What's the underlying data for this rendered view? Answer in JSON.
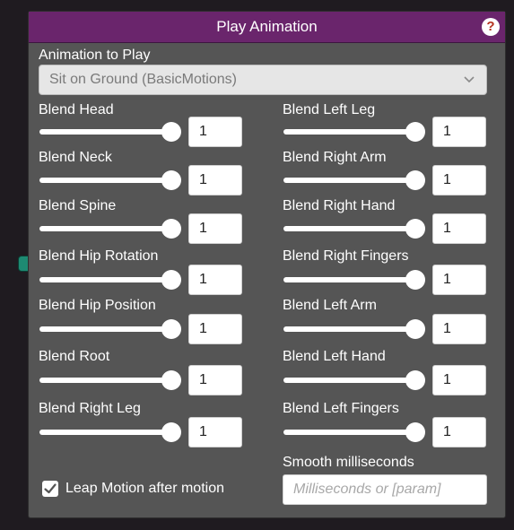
{
  "node": {
    "title": "Play Animation",
    "help_glyph": "?",
    "animation_label": "Animation to Play",
    "animation_value": "Sit on Ground (BasicMotions)",
    "left_blends": [
      {
        "label": "Blend Head",
        "value": "1",
        "level": 1
      },
      {
        "label": "Blend Neck",
        "value": "1",
        "level": 1
      },
      {
        "label": "Blend Spine",
        "value": "1",
        "level": 1
      },
      {
        "label": "Blend Hip Rotation",
        "value": "1",
        "level": 1
      },
      {
        "label": "Blend Hip Position",
        "value": "1",
        "level": 1
      },
      {
        "label": "Blend Root",
        "value": "1",
        "level": 1
      },
      {
        "label": "Blend Right Leg",
        "value": "1",
        "level": 1
      }
    ],
    "right_blends": [
      {
        "label": "Blend Left Leg",
        "value": "1",
        "level": 1
      },
      {
        "label": "Blend Right Arm",
        "value": "1",
        "level": 1
      },
      {
        "label": "Blend Right Hand",
        "value": "1",
        "level": 1
      },
      {
        "label": "Blend Right Fingers",
        "value": "1",
        "level": 1
      },
      {
        "label": "Blend Left Arm",
        "value": "1",
        "level": 1
      },
      {
        "label": "Blend Left Hand",
        "value": "1",
        "level": 1
      },
      {
        "label": "Blend Left Fingers",
        "value": "1",
        "level": 1
      }
    ],
    "leap_motion": {
      "label": "Leap Motion after motion",
      "checked": true
    },
    "smooth_label": "Smooth milliseconds",
    "smooth_placeholder": "Milliseconds or [param]"
  },
  "colors": {
    "title_bar": "#6a256c",
    "panel": "#555555",
    "port": "#1e8a72",
    "help_icon": "#b4321f"
  },
  "icons": [
    "help-icon",
    "chevron-down-icon",
    "checkmark-icon",
    "input-port-icon"
  ]
}
